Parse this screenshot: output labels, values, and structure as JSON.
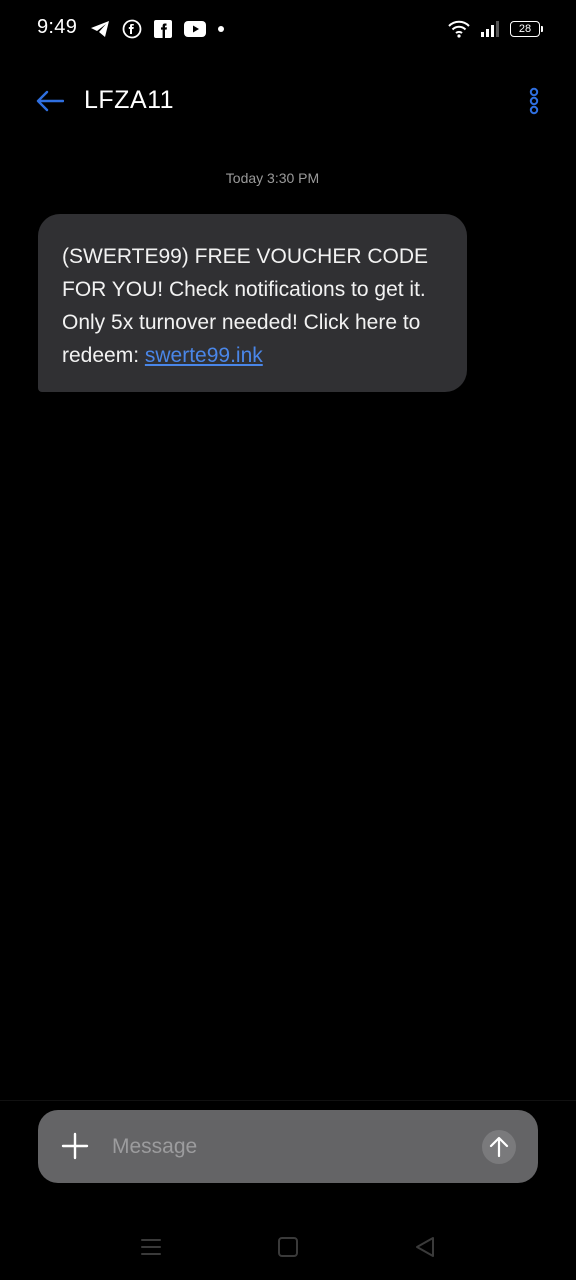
{
  "status_bar": {
    "time": "9:49",
    "battery_level": "28",
    "left_icons": [
      "telegram-icon",
      "facebook-messenger-icon",
      "facebook-icon",
      "youtube-icon",
      "notification-dot"
    ],
    "right_icons": [
      "wifi-icon",
      "signal-icon",
      "battery-icon"
    ]
  },
  "app_bar": {
    "contact_name": "LFZA11"
  },
  "conversation": {
    "timestamp": "Today 3:30 PM",
    "messages": [
      {
        "text": "(SWERTE99) FREE VOUCHER CODE FOR YOU! Check notifications to get it. Only 5x turnover needed! Click here to redeem: ",
        "link": "swerte99.ink"
      }
    ]
  },
  "compose": {
    "placeholder": "Message",
    "value": ""
  },
  "colors": {
    "accent": "#2f6fe0",
    "bubble": "#303033",
    "link": "#4a86e8",
    "compose_bg": "#646466"
  }
}
